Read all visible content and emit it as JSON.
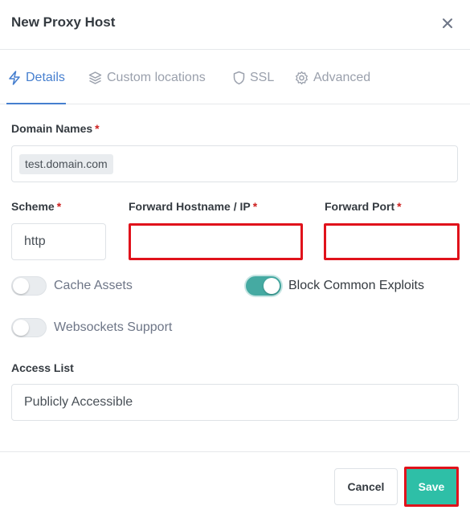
{
  "modal": {
    "title": "New Proxy Host",
    "close_label": "×"
  },
  "tabs": [
    {
      "label": "Details",
      "icon": "bolt-icon",
      "active": true
    },
    {
      "label": "Custom locations",
      "icon": "layers-icon",
      "active": false
    },
    {
      "label": "SSL",
      "icon": "shield-icon",
      "active": false
    },
    {
      "label": "Advanced",
      "icon": "gear-icon",
      "active": false
    }
  ],
  "form": {
    "required_marker": "*",
    "domain_names": {
      "label": "Domain Names",
      "tags": [
        "test.domain.com"
      ]
    },
    "scheme": {
      "label": "Scheme",
      "value": "http"
    },
    "forward_hostname": {
      "label": "Forward Hostname / IP",
      "value": ""
    },
    "forward_port": {
      "label": "Forward Port",
      "value": ""
    },
    "cache_assets": {
      "label": "Cache Assets",
      "enabled": false
    },
    "block_common_exploits": {
      "label": "Block Common Exploits",
      "enabled": true
    },
    "websockets_support": {
      "label": "Websockets Support",
      "enabled": false
    },
    "access_list": {
      "label": "Access List",
      "value": "Publicly Accessible"
    }
  },
  "footer": {
    "cancel_label": "Cancel",
    "save_label": "Save"
  },
  "colors": {
    "accent": "#467fcf",
    "toggle_on": "#45aaa2",
    "save_button": "#2ebfa7",
    "required": "#cd201f",
    "error_highlight": "#e0121b"
  }
}
